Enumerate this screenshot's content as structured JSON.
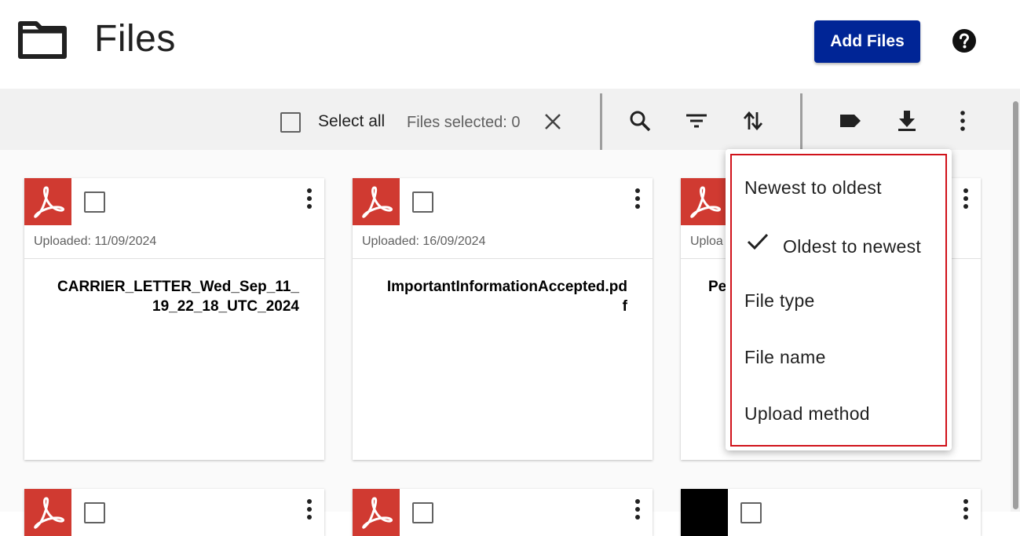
{
  "header": {
    "title": "Files",
    "add_button": "Add Files",
    "accent_color": "#002596"
  },
  "toolbar": {
    "select_all": "Select all",
    "files_selected": "Files selected: 0"
  },
  "cards": [
    {
      "uploaded": "Uploaded: 11/09/2024",
      "title": "CARRIER_LETTER_Wed_Sep_11_19_22_18_UTC_2024",
      "type": "pdf"
    },
    {
      "uploaded": "Uploaded: 16/09/2024",
      "title": "ImportantInformationAccepted.pdf",
      "type": "pdf"
    },
    {
      "uploaded": "Uploa",
      "title": "Pe",
      "type": "pdf"
    }
  ],
  "sort_menu": {
    "items": [
      {
        "label": "Newest to oldest",
        "selected": false
      },
      {
        "label": "Oldest to newest",
        "selected": true
      },
      {
        "label": "File type",
        "selected": false
      },
      {
        "label": "File name",
        "selected": false
      },
      {
        "label": "Upload method",
        "selected": false
      }
    ],
    "highlight_color": "#d0121a"
  },
  "icons": [
    "folder-icon",
    "help-icon",
    "close-icon",
    "search-icon",
    "filter-icon",
    "sort-icon",
    "label-icon",
    "download-icon",
    "more-vert-icon",
    "pdf-icon",
    "check-icon"
  ]
}
